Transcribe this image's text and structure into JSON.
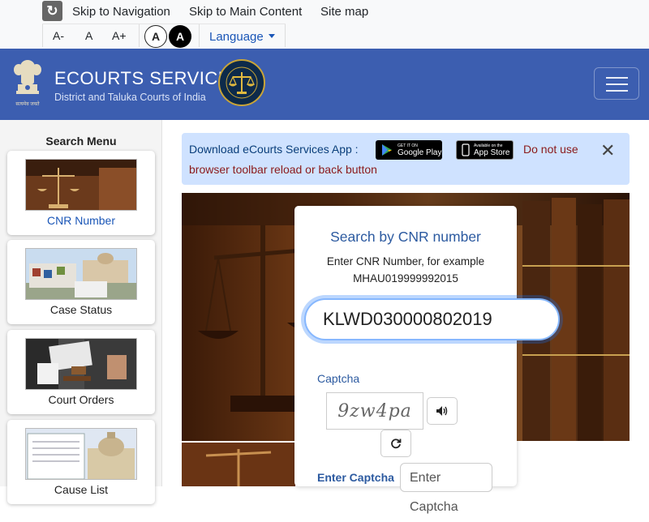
{
  "topbar": {
    "skip_nav": "Skip to Navigation",
    "skip_main": "Skip to Main Content",
    "sitemap": "Site map",
    "font_decrease": "A-",
    "font_normal": "A",
    "font_increase": "A+",
    "contrast_light": "A",
    "contrast_dark": "A",
    "language": "Language"
  },
  "header": {
    "title": "ECOURTS SERVICES",
    "subtitle": "District and Taluka Courts of India",
    "emblem_text": "सत्यमेव जयते"
  },
  "sidebar": {
    "title": "Search Menu",
    "items": [
      {
        "label": "CNR Number",
        "active": true
      },
      {
        "label": "Case Status",
        "active": false
      },
      {
        "label": "Court Orders",
        "active": false
      },
      {
        "label": "Cause List",
        "active": false
      }
    ]
  },
  "alert": {
    "download_text": "Download eCourts Services App :",
    "google_small": "GET IT ON",
    "google_big": "Google Play",
    "apple_small": "Available on the",
    "apple_big": "App Store",
    "warning_part1": "Do not use",
    "warning_part2": "browser toolbar reload or back button",
    "close": "✕"
  },
  "search": {
    "title": "Search by CNR number",
    "hint_line1": "Enter CNR Number, for example",
    "hint_line2": "MHAU019999992015",
    "cnr_value": "KLWD030000802019",
    "captcha_label": "Captcha",
    "captcha_text": "9zw4pa",
    "enter_captcha_label": "Enter Captcha",
    "enter_captcha_placeholder": "Enter Captcha"
  },
  "colors": {
    "header_bg": "#3c5eb0",
    "alert_bg": "#cfe2ff",
    "accent": "#2c5aa0",
    "warning_text": "#8b1a1a"
  }
}
